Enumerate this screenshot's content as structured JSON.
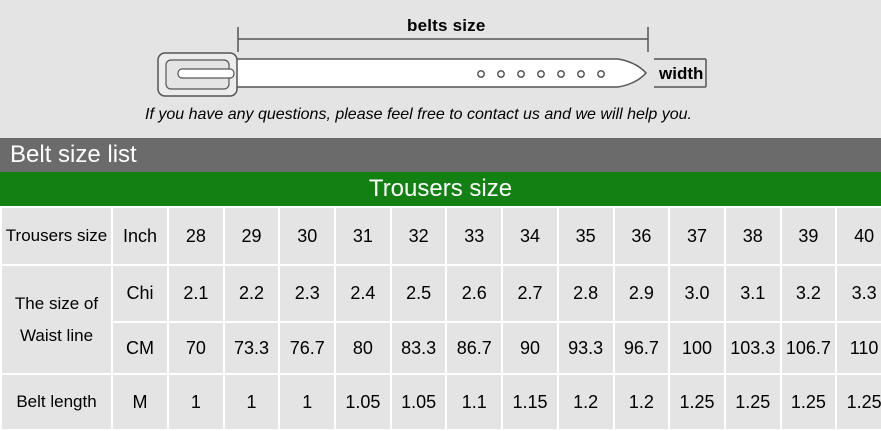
{
  "diagram": {
    "belts_size_label": "belts size",
    "width_label": "width",
    "contact_note": "If you have any questions, please feel free to contact us and we will help you.",
    "hole_count": 7
  },
  "section_bar": {
    "label": "Belt size  list"
  },
  "trousers_bar": {
    "label": "Trousers size"
  },
  "table": {
    "rows": [
      {
        "header": "Trousers size",
        "unit": "Inch",
        "values": [
          "28",
          "29",
          "30",
          "31",
          "32",
          "33",
          "34",
          "35",
          "36",
          "37",
          "38",
          "39",
          "40"
        ]
      },
      {
        "header_line1": "The size of",
        "header_line2": "Waist line",
        "unit": "Chi",
        "values": [
          "2.1",
          "2.2",
          "2.3",
          "2.4",
          "2.5",
          "2.6",
          "2.7",
          "2.8",
          "2.9",
          "3.0",
          "3.1",
          "3.2",
          "3.3"
        ]
      },
      {
        "unit": "CM",
        "values": [
          "70",
          "73.3",
          "76.7",
          "80",
          "83.3",
          "86.7",
          "90",
          "93.3",
          "96.7",
          "100",
          "103.3",
          "106.7",
          "110"
        ]
      },
      {
        "header": "Belt length",
        "unit": "M",
        "values": [
          "1",
          "1",
          "1",
          "1.05",
          "1.05",
          "1.1",
          "1.15",
          "1.2",
          "1.2",
          "1.25",
          "1.25",
          "1.25",
          "1.25"
        ]
      }
    ]
  },
  "colors": {
    "background": "#e4e4e4",
    "list_bar": "#6b6b6b",
    "trousers_bar": "#138014",
    "grid_lines": "#ffffff"
  }
}
